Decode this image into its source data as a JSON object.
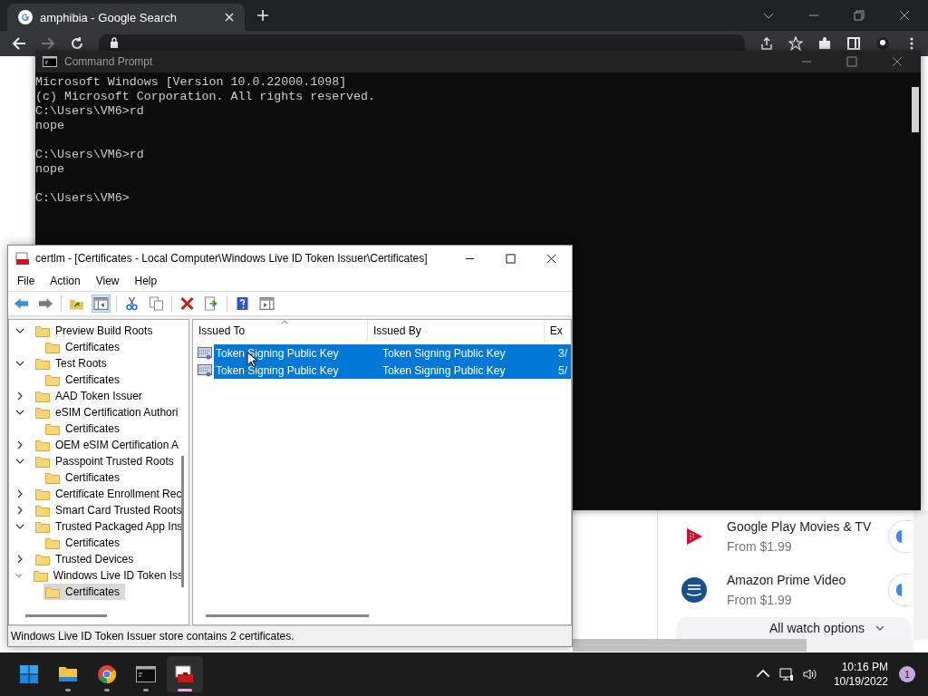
{
  "browser": {
    "tab": {
      "title": "amphibia - Google Search"
    },
    "watch_options": [
      {
        "kind": "play",
        "name": "Google Play Movies & TV",
        "price": "From $1.99"
      },
      {
        "kind": "prime",
        "name": "Amazon Prime Video",
        "price": "From $1.99"
      }
    ],
    "more_button": "All watch options"
  },
  "command_prompt": {
    "title": "Command Prompt",
    "blocks": [
      [
        "Microsoft Windows [Version 10.0.22000.1098]",
        "(c) Microsoft Corporation. All rights reserved.",
        "C:\\Users\\VM6>rd",
        "nope"
      ],
      [
        "C:\\Users\\VM6>rd",
        "nope"
      ],
      [
        "C:\\Users\\VM6>"
      ]
    ]
  },
  "certlm": {
    "title": "certlm - [Certificates - Local Computer\\Windows Live ID Token Issuer\\Certificates]",
    "menu": [
      "File",
      "Action",
      "View",
      "Help"
    ],
    "tree": [
      {
        "label": "Preview Build Roots",
        "expanded": true,
        "selected": false,
        "children": [
          {
            "label": "Certificates",
            "selected": false
          }
        ]
      },
      {
        "label": "Test Roots",
        "expanded": true,
        "selected": false,
        "children": [
          {
            "label": "Certificates",
            "selected": false
          }
        ]
      },
      {
        "label": "AAD Token Issuer",
        "expanded": false,
        "selected": false
      },
      {
        "label": "eSIM Certification Authori",
        "expanded": true,
        "selected": false,
        "children": [
          {
            "label": "Certificates",
            "selected": false
          }
        ]
      },
      {
        "label": "OEM eSIM Certification A",
        "expanded": false,
        "selected": false
      },
      {
        "label": "Passpoint Trusted Roots",
        "expanded": true,
        "selected": false,
        "children": [
          {
            "label": "Certificates",
            "selected": false
          }
        ]
      },
      {
        "label": "Certificate Enrollment Rec",
        "expanded": false,
        "selected": false
      },
      {
        "label": "Smart Card Trusted Roots",
        "expanded": false,
        "selected": false
      },
      {
        "label": "Trusted Packaged App Ins",
        "expanded": true,
        "selected": false,
        "children": [
          {
            "label": "Certificates",
            "selected": false
          }
        ]
      },
      {
        "label": "Trusted Devices",
        "expanded": false,
        "selected": false
      },
      {
        "label": "Windows Live ID Token Iss",
        "expanded": true,
        "selected": false,
        "children": [
          {
            "label": "Certificates",
            "selected": true
          }
        ]
      }
    ],
    "columns": [
      "Issued To",
      "Issued By",
      "Ex"
    ],
    "rows": [
      {
        "cells": [
          "Token Signing Public Key",
          "Token Signing Public Key",
          "3/"
        ],
        "selected": true
      },
      {
        "cells": [
          "Token Signing Public Key",
          "Token Signing Public Key",
          "5/"
        ],
        "selected": true
      }
    ],
    "status": "Windows Live ID Token Issuer store contains 2 certificates."
  },
  "taskbar": {
    "apps": [
      {
        "kind": "start",
        "active": false
      },
      {
        "kind": "explorer",
        "active": false
      },
      {
        "kind": "chrome",
        "active": false
      },
      {
        "kind": "terminal",
        "active": false
      },
      {
        "kind": "certlm",
        "active": true
      }
    ],
    "time": "10:16 PM",
    "date": "10/19/2022",
    "notifications": "1"
  }
}
